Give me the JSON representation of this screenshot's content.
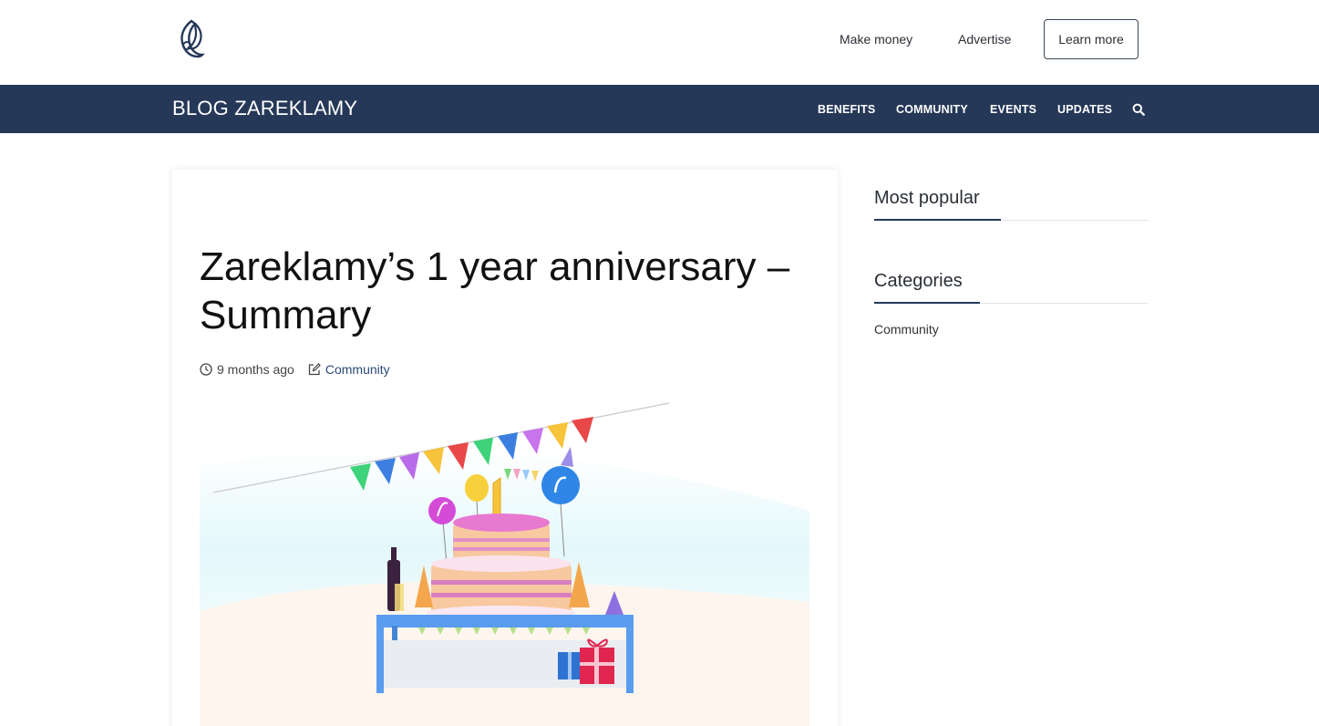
{
  "header": {
    "logo_icon": "zareklamy-leaf-logo",
    "links": {
      "make_money": "Make money",
      "advertise": "Advertise"
    },
    "learn_more": "Learn more"
  },
  "nav": {
    "brand": "BLOG ZAREKLAMY",
    "items": [
      "BENEFITS",
      "COMMUNITY",
      "EVENTS",
      "UPDATES"
    ],
    "search_icon": "search-icon"
  },
  "article": {
    "title": "Zareklamy’s 1 year anniversary – Summary",
    "time_ago": "9 months ago",
    "category": "Community",
    "hero_image": "birthday-cake-illustration"
  },
  "sidebar": {
    "most_popular": "Most popular",
    "categories": "Categories",
    "category_links": [
      "Community"
    ]
  },
  "colors": {
    "nav_bg": "#253858",
    "accent": "#2c4a7a"
  }
}
